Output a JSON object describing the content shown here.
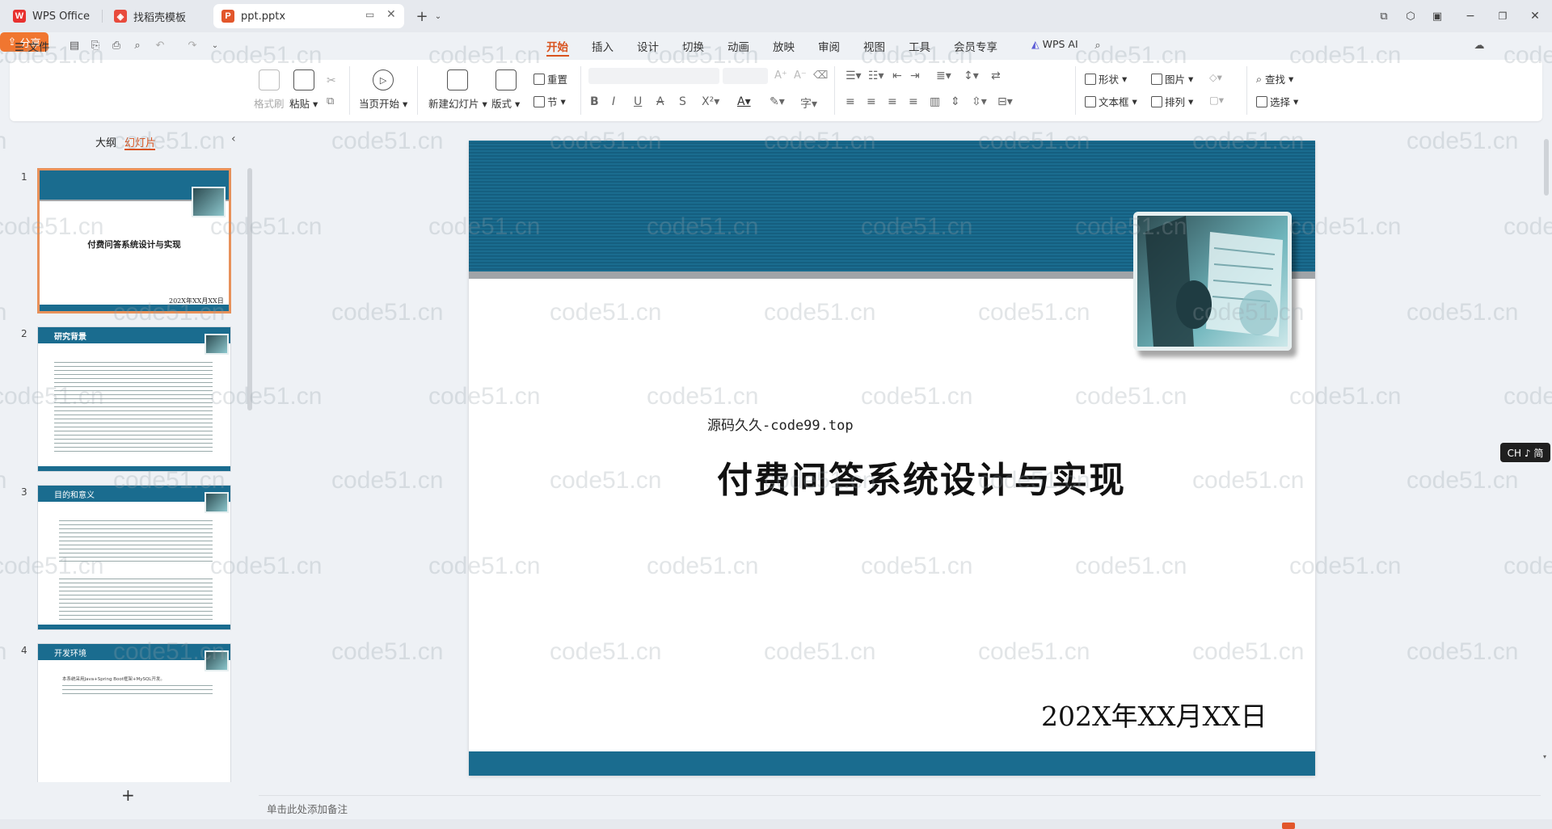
{
  "tabs": [
    {
      "label": "WPS Office",
      "icon": "wps-logo-icon"
    },
    {
      "label": "找稻壳模板",
      "icon": "docer-icon"
    },
    {
      "label": "ppt.pptx",
      "icon": "ppt-file-icon"
    }
  ],
  "menu": {
    "file": "文件",
    "tabs": [
      "开始",
      "插入",
      "设计",
      "切换",
      "动画",
      "放映",
      "审阅",
      "视图",
      "工具",
      "会员专享"
    ],
    "active_tab": "开始",
    "wps_ai": "WPS AI",
    "share": "分享"
  },
  "ribbon": {
    "format_painter": "格式刷",
    "paste": "粘贴",
    "play_from_current": "当页开始",
    "new_slide": "新建幻灯片",
    "layout": "版式",
    "section": "节",
    "reset": "重置",
    "shape": "形状",
    "picture": "图片",
    "textbox": "文本框",
    "arrange": "排列",
    "find": "查找",
    "select": "选择"
  },
  "panel": {
    "tab_outline": "大纲",
    "tab_slides": "幻灯片",
    "add": "+"
  },
  "thumbnails": [
    {
      "num": "1",
      "title": "付费问答系统设计与实现",
      "date": "202X年XX月XX日"
    },
    {
      "num": "2",
      "heading": "研究背景"
    },
    {
      "num": "3",
      "heading": "目的和意义"
    },
    {
      "num": "4",
      "heading": "开发环境",
      "line": "本系统采用Java+Spring Boot框架+MySQL开发。"
    }
  ],
  "slide": {
    "subtitle": "源码久久-code99.top",
    "title": "付费问答系统设计与实现",
    "date": "202X年XX月XX日"
  },
  "notes_placeholder": "单击此处添加备注",
  "ime": "CH ♪ 简",
  "watermark": "code51.cn",
  "colors": {
    "accent": "#d9531e",
    "slide_blue": "#1a6c8f",
    "share": "#f07630"
  }
}
